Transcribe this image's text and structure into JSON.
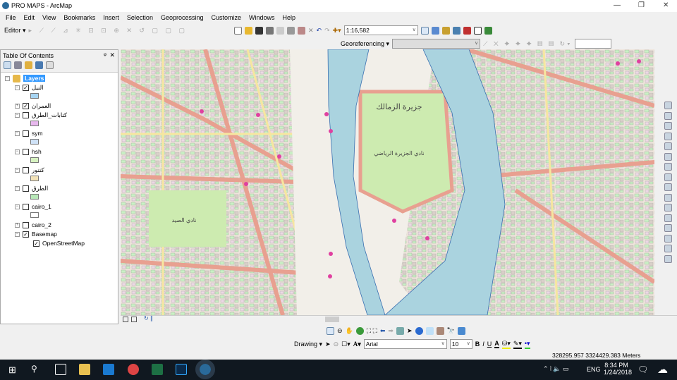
{
  "window": {
    "title": "PRO MAPS - ArcMap"
  },
  "menu": [
    "File",
    "Edit",
    "View",
    "Bookmarks",
    "Insert",
    "Selection",
    "Geoprocessing",
    "Customize",
    "Windows",
    "Help"
  ],
  "toolbar": {
    "editor_label": "Editor",
    "scale_value": "1:16,582",
    "georeferencing_label": "Georeferencing"
  },
  "toc": {
    "title": "Table Of Contents",
    "root": "Layers",
    "layers": [
      {
        "name": "النيل",
        "checked": true,
        "swatch": "#a6d4f2"
      },
      {
        "name": "العمران",
        "checked": true,
        "swatch": null
      },
      {
        "name": "كتابات_الطرق",
        "checked": false,
        "swatch": "#e8b8ee"
      },
      {
        "name": "sym",
        "checked": false,
        "swatch": "#cfe2f7"
      },
      {
        "name": "hsh",
        "checked": false,
        "swatch": "#d6f2c0"
      },
      {
        "name": "كنتور",
        "checked": false,
        "swatch": "#f2e2b8"
      },
      {
        "name": "الطرق",
        "checked": false,
        "swatch": "#b8e8b8"
      },
      {
        "name": "cairo_1",
        "checked": false,
        "swatch": "#ffffff"
      },
      {
        "name": "cairo_2",
        "checked": false,
        "swatch": null
      },
      {
        "name": "Basemap",
        "checked": true,
        "swatch": null
      },
      {
        "name": "OpenStreetMap",
        "checked": true,
        "swatch": null
      }
    ]
  },
  "map": {
    "labels": [
      "جزيرة الزمالك",
      "نادي الجزيرة الرياضي",
      "نادي الصيد"
    ]
  },
  "drawing": {
    "label": "Drawing",
    "font": "Arial",
    "size": "10",
    "bold": "B",
    "italic": "I",
    "underline": "U",
    "font_color": "A"
  },
  "status": {
    "coords": "328295.957  3324429.383 Meters"
  },
  "taskbar": {
    "lang": "ENG",
    "time": "8:34 PM",
    "date": "1/24/2018"
  }
}
